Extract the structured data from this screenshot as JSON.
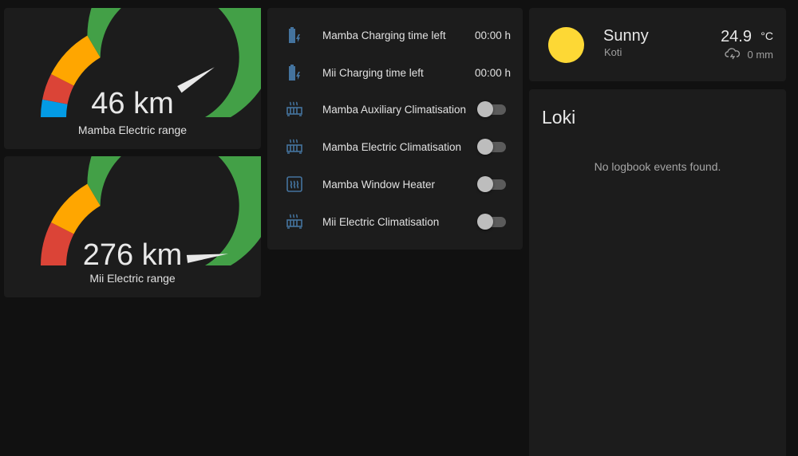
{
  "colors": {
    "background": "#111111",
    "card": "#1c1c1c",
    "gauge_green": "#43a047",
    "gauge_orange": "#ffa600",
    "gauge_red": "#db4437",
    "gauge_blue": "#039be5",
    "icon_blue": "#44739e",
    "sun_yellow": "#fdd835"
  },
  "gauges": [
    {
      "value_text": "46 km",
      "name": "Mamba Electric range",
      "level_fraction": 0.82,
      "segments": [
        "blue",
        "red",
        "orange",
        "green"
      ]
    },
    {
      "value_text": "276 km",
      "name": "Mii Electric range",
      "level_fraction": 0.96,
      "segments": [
        "red",
        "orange",
        "green"
      ]
    }
  ],
  "entities": [
    {
      "icon": "battery-charging-icon",
      "label": "Mamba Charging time left",
      "state": "00:00 h",
      "type": "sensor"
    },
    {
      "icon": "battery-charging-icon",
      "label": "Mii Charging time left",
      "state": "00:00 h",
      "type": "sensor"
    },
    {
      "icon": "radiator-icon",
      "label": "Mamba Auxiliary Climatisation",
      "state": "off",
      "type": "switch"
    },
    {
      "icon": "radiator-icon",
      "label": "Mamba Electric Climatisation",
      "state": "off",
      "type": "switch"
    },
    {
      "icon": "window-heater-icon",
      "label": "Mamba Window Heater",
      "state": "off",
      "type": "switch"
    },
    {
      "icon": "radiator-icon",
      "label": "Mii Electric Climatisation",
      "state": "off",
      "type": "switch"
    }
  ],
  "weather": {
    "icon": "sun-icon",
    "condition": "Sunny",
    "location": "Koti",
    "temperature": "24.9",
    "unit": "°C",
    "precip_icon": "cloud-rain-icon",
    "precipitation": "0 mm"
  },
  "logbook": {
    "title": "Loki",
    "empty_text": "No logbook events found."
  }
}
